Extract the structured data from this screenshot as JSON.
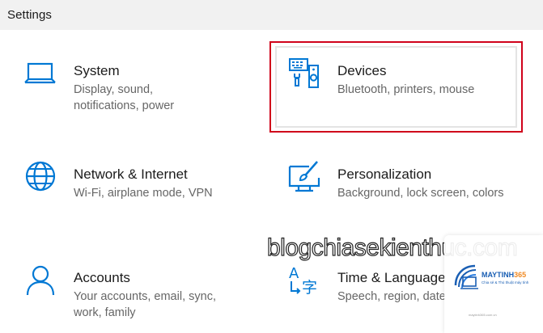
{
  "window": {
    "title": "Settings"
  },
  "tiles": [
    {
      "name": "System",
      "desc": "Display, sound, notifications, power",
      "icon": "laptop-icon"
    },
    {
      "name": "Devices",
      "desc": "Bluetooth, printers, mouse",
      "icon": "devices-icon",
      "selected": true
    },
    {
      "name": "Network & Internet",
      "desc": "Wi-Fi, airplane mode, VPN",
      "icon": "globe-icon"
    },
    {
      "name": "Personalization",
      "desc": "Background, lock screen, colors",
      "icon": "paintbrush-icon"
    },
    {
      "name": "Accounts",
      "desc": "Your accounts, email, sync, work, family",
      "icon": "person-icon"
    },
    {
      "name": "Time & Language",
      "desc": "Speech, region, date",
      "icon": "time-language-icon"
    }
  ],
  "watermark": {
    "text": "blogchiasekienthuc.com"
  },
  "logo": {
    "brand_part1": "MAYTINH",
    "brand_part2": "365",
    "tagline": "Chia sẻ & Thủ thuật máy tính",
    "site": "maytinh365.com.vn"
  },
  "colors": {
    "accent": "#0078d4",
    "highlight": "#d0021b",
    "titlebar": "#f1f1f1"
  }
}
